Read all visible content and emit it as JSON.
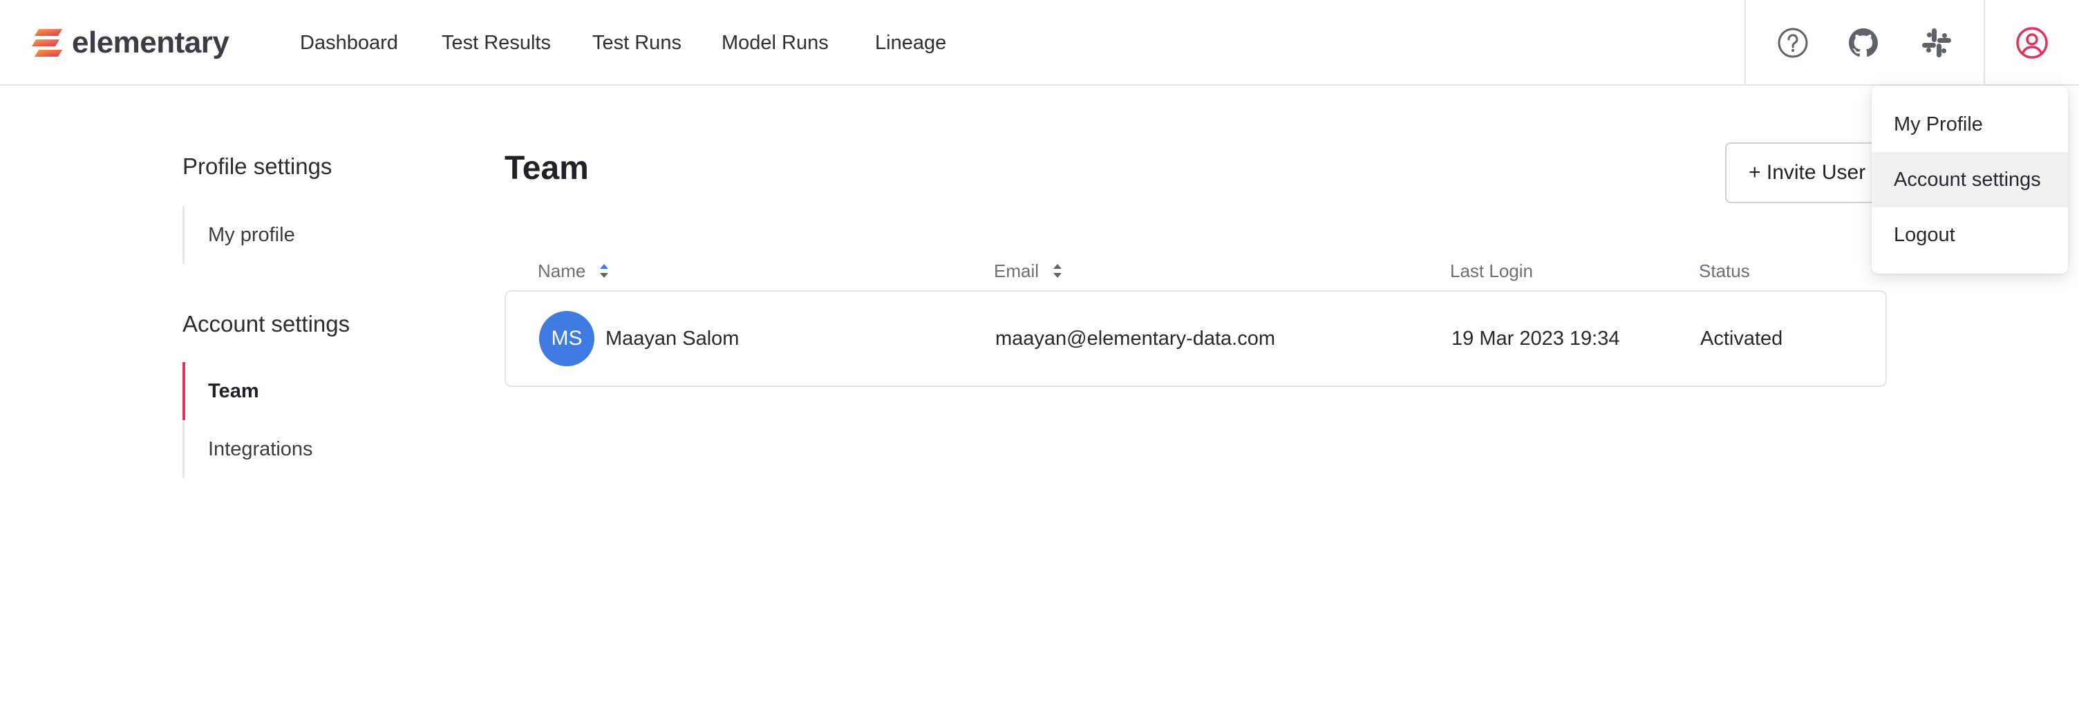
{
  "app": {
    "logo_text": "elementary"
  },
  "nav": {
    "items": [
      {
        "label": "Dashboard"
      },
      {
        "label": "Test Results"
      },
      {
        "label": "Test Runs"
      },
      {
        "label": "Model Runs"
      },
      {
        "label": "Lineage"
      }
    ]
  },
  "top_icons": [
    "help-icon",
    "github-icon",
    "slack-icon",
    "user-account-icon"
  ],
  "colors": {
    "accent": "#e0335c",
    "avatar_bg": "#3f7ae0",
    "sort_active": "#3f7ae0"
  },
  "sidebar": {
    "profile_heading": "Profile settings",
    "profile_items": [
      {
        "label": "My profile"
      }
    ],
    "account_heading": "Account settings",
    "account_items": [
      {
        "label": "Team",
        "active": true
      },
      {
        "label": "Integrations",
        "active": false
      }
    ]
  },
  "main": {
    "title": "Team",
    "invite_button": "+ Invite User",
    "table": {
      "columns": [
        {
          "label": "Name",
          "sortable": true
        },
        {
          "label": "Email",
          "sortable": true
        },
        {
          "label": "Last Login",
          "sortable": false
        },
        {
          "label": "Status",
          "sortable": false
        }
      ],
      "rows": [
        {
          "initials": "MS",
          "name": "Maayan Salom",
          "email": "maayan@elementary-data.com",
          "last_login": "19 Mar 2023 19:34",
          "status": "Activated"
        }
      ]
    }
  },
  "user_menu": {
    "items": [
      {
        "label": "My Profile"
      },
      {
        "label": "Account settings",
        "hovered": true
      },
      {
        "label": "Logout"
      }
    ]
  }
}
